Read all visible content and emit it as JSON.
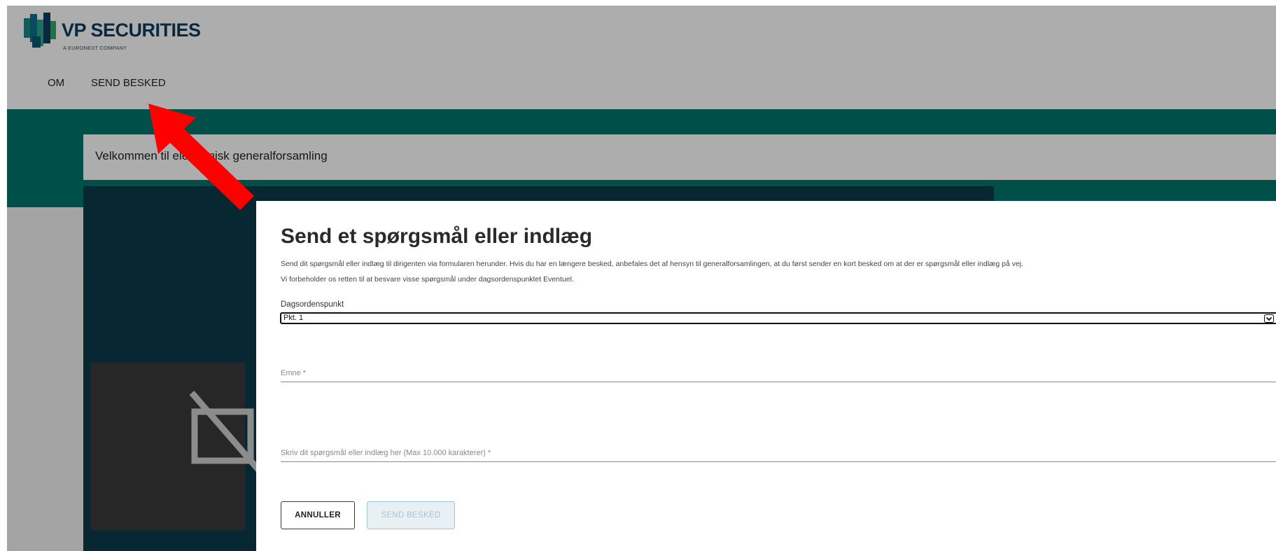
{
  "header": {
    "logo_text": "VP SECURITIES",
    "logo_subtext": "A EURONEXT COMPANY"
  },
  "nav": {
    "items": [
      {
        "label": "OM"
      },
      {
        "label": "SEND BESKED"
      }
    ]
  },
  "welcome": {
    "text": "Velkommen til elektronisk generalforsamling"
  },
  "modal": {
    "title": "Send et spørgsmål eller indlæg",
    "description_line1": "Send dit spørgsmål eller indlæg til dirigenten via formularen herunder. Hvis du har en længere besked, anbefales det af hensyn til generalforsamlingen, at du først sender en kort besked om at der er spørgsmål eller indlæg på vej.",
    "description_line2": "Vi forbeholder os retten til at besvare visse spørgsmål under dagsordenspunktet Eventuel.",
    "agenda_label": "Dagsordenspunkt",
    "agenda_value": "Pkt. 1",
    "subject_placeholder": "Emne *",
    "message_placeholder": "Skriv dit spørgsmål eller indlæg her (Max 10.000 karakterer) *",
    "cancel_label": "ANNULLER",
    "send_label": "SEND BESKED"
  },
  "colors": {
    "teal_band": "#00756a",
    "logo_blue": "#0c3d5e",
    "annotation_arrow": "#ff0000",
    "video_background": "#0b3a4c"
  },
  "icons": {
    "camera_off": "camera-off-icon",
    "chevron_down": "chevron-down-icon"
  }
}
